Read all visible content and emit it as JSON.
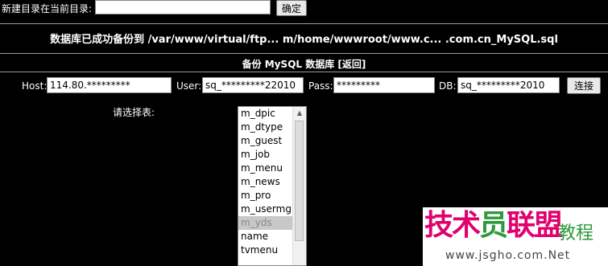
{
  "mkdir": {
    "label": "新建目录在当前目录:",
    "value": "",
    "confirm": "确定"
  },
  "backup_message": "数据库已成功备份到 /var/www/virtual/ftp... m/home/wwwroot/www.c...      .com.cn_MySQL.sql",
  "section_title": "备份 MySQL 数据库 [返回]",
  "connection": {
    "host_label": "Host:",
    "host_value": "114.80.*********",
    "user_label": "User:",
    "user_value": "sq_*********22010",
    "pass_label": "Pass:",
    "pass_value": "*********",
    "db_label": "DB:",
    "db_value": "sq_*********2010",
    "connect": "连接"
  },
  "tables": {
    "prompt": "请选择表:",
    "items": [
      "m_dpic",
      "m_dtype",
      "m_guest",
      "m_job",
      "m_menu",
      "m_news",
      "m_pro",
      "m_usermgr",
      "m_yds",
      "name",
      "tvmenu"
    ],
    "selected": "m_yds"
  },
  "watermark": {
    "brand_pink": "技术",
    "brand_green": "员",
    "brand_pink2": "联盟",
    "suffix": "教程",
    "url": "www.jsgho.com.Net"
  }
}
